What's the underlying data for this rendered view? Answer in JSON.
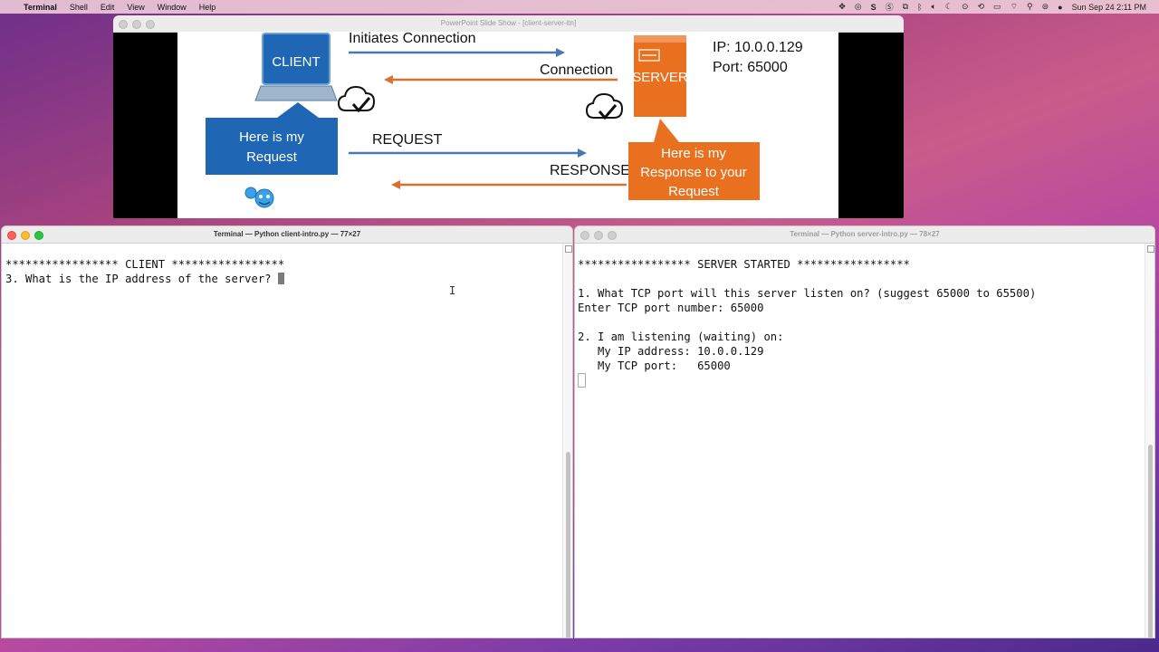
{
  "menubar": {
    "app": "Terminal",
    "menus": [
      "Shell",
      "Edit",
      "View",
      "Window",
      "Help"
    ],
    "clock": "Sun Sep 24  2:11 PM"
  },
  "ppt_window": {
    "title": "PowerPoint Slide Show - [client-server-itn]"
  },
  "slide": {
    "client_label": "CLIENT",
    "server_label": "SERVER",
    "initiates": "Initiates Connection",
    "connection": "Connection",
    "request": "REQUEST",
    "response": "RESPONSE",
    "server_ip": "IP: 10.0.0.129",
    "server_port": "Port: 65000",
    "client_bubble_l1": "Here is my",
    "client_bubble_l2": "Request",
    "server_bubble_l1": "Here is my",
    "server_bubble_l2": "Response to your",
    "server_bubble_l3": "Request",
    "colors": {
      "blue": "#1f66b5",
      "orange": "#e8701e",
      "arrow_blue": "#4a78b5",
      "arrow_orange": "#d9702b"
    }
  },
  "client_terminal": {
    "title": "Terminal — Python client-intro.py — 77×27",
    "lines": [
      "***************** CLIENT *****************",
      "3. What is the IP address of the server? "
    ]
  },
  "server_terminal": {
    "title": "Terminal — Python server-intro.py — 78×27",
    "lines": [
      "***************** SERVER STARTED *****************",
      "",
      "1. What TCP port will this server listen on? (suggest 65000 to 65500)",
      "Enter TCP port number: 65000",
      "",
      "2. I am listening (waiting) on:",
      "   My IP address: 10.0.0.129",
      "   My TCP port:   65000"
    ]
  }
}
